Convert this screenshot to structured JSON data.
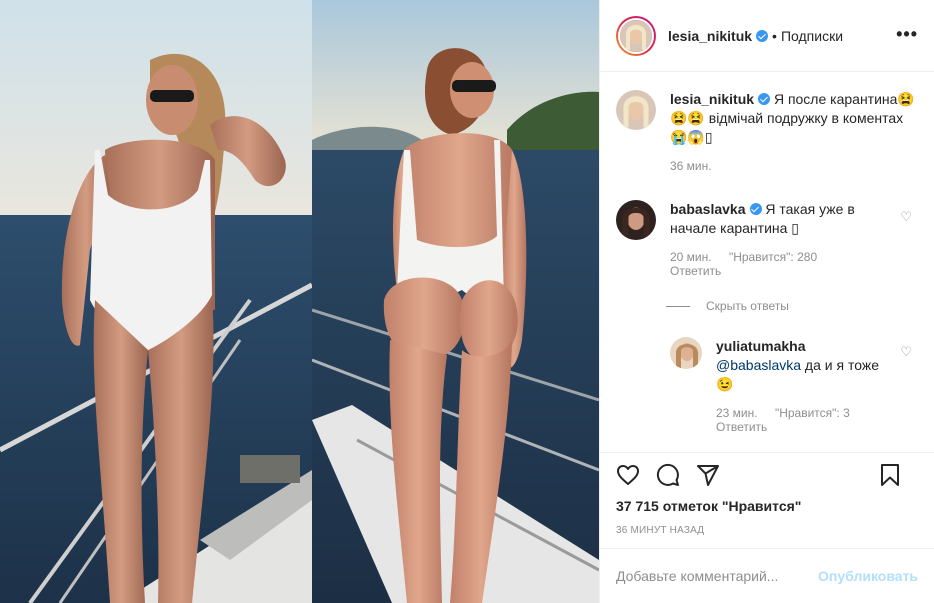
{
  "header": {
    "username": "lesia_nikituk",
    "separator": "•",
    "follow_label": "Подписки",
    "more_label": "•••"
  },
  "caption": {
    "username": "lesia_nikituk",
    "text": "Я после карантина😫😫😫 відмічай подружку в коментах 😭😱▯",
    "time": "36 мин."
  },
  "comments": [
    {
      "username": "babaslavka",
      "text": "Я такая уже в начале карантина ▯",
      "time": "20 мин.",
      "likes": "\"Нравится\": 280",
      "reply_label": "Ответить"
    }
  ],
  "hide_replies_label": "Скрыть ответы",
  "reply": {
    "username": "yuliatumakha",
    "mention": "@babaslavka",
    "text": " да и я тоже 😉",
    "time": "23 мин.",
    "likes": "\"Нравится\": 3",
    "reply_label": "Ответить"
  },
  "likes_text": "37 715 отметок \"Нравится\"",
  "posted_time": "36 минут назад",
  "comment_box": {
    "placeholder": "Добавьте комментарий...",
    "publish_label": "Опубликовать"
  },
  "icons": [
    "heart-icon",
    "comment-icon",
    "share-icon",
    "bookmark-icon",
    "more-icon",
    "verified-icon"
  ],
  "colors": {
    "verified": "#3897f0",
    "publish_disabled": "#b2dffc",
    "meta": "#8e8e8e",
    "link": "#00376b"
  }
}
